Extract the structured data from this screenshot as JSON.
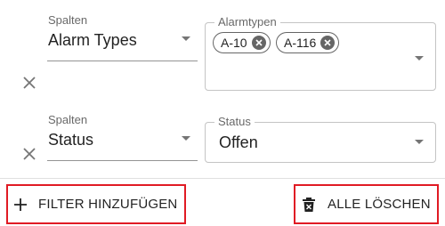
{
  "filters": [
    {
      "column_label": "Spalten",
      "column_value": "Alarm Types",
      "value_label": "Alarmtypen",
      "chips": [
        "A-10",
        "A-116"
      ],
      "remove_icon": "close-icon"
    },
    {
      "column_label": "Spalten",
      "column_value": "Status",
      "value_label": "Status",
      "value_value": "Offen",
      "remove_icon": "close-icon"
    }
  ],
  "actions": {
    "add_filter_label": "FILTER HINZUFÜGEN",
    "add_filter_icon": "plus-icon",
    "clear_all_label": "ALLE LÖSCHEN",
    "clear_all_icon": "trash-icon"
  },
  "colors": {
    "highlight_border": "#e01b24"
  }
}
